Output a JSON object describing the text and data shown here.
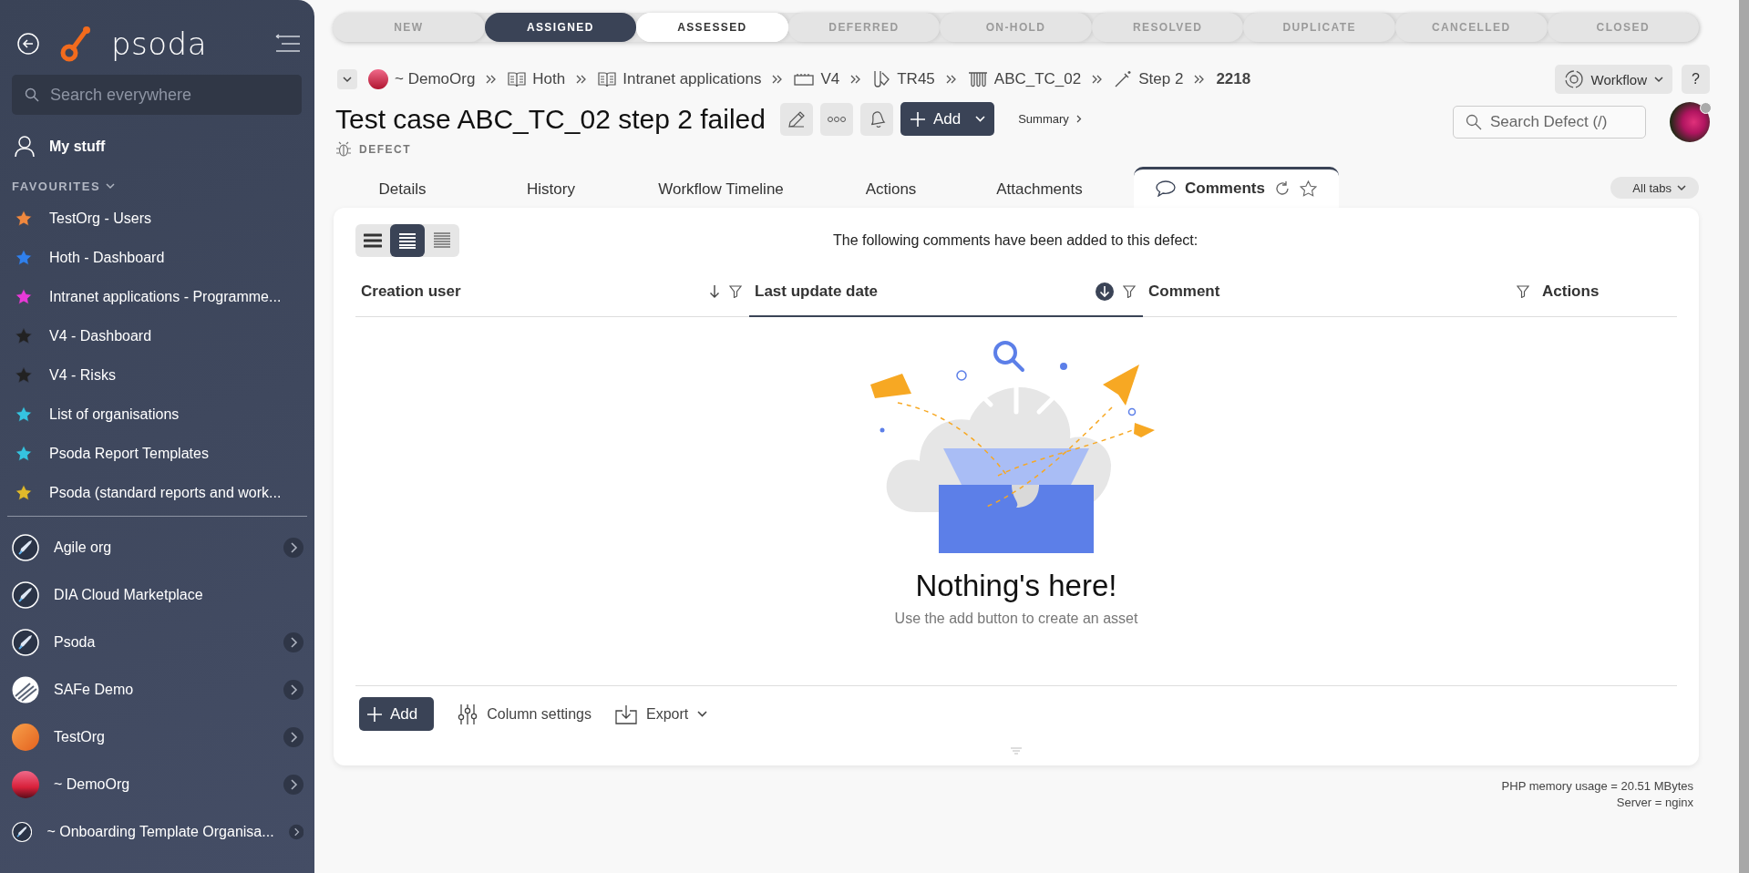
{
  "sidebar": {
    "brand": "psoda",
    "search_placeholder": "Search everywhere",
    "my_stuff": "My stuff",
    "favourites_heading": "FAVOURITES",
    "favourites": [
      {
        "label": "TestOrg - Users",
        "color": "#f0883e"
      },
      {
        "label": "Hoth - Dashboard",
        "color": "#2f80ed"
      },
      {
        "label": "Intranet applications - Programme...",
        "color": "#e83ad8"
      },
      {
        "label": "V4 - Dashboard",
        "color": "#222222"
      },
      {
        "label": "V4 - Risks",
        "color": "#222222"
      },
      {
        "label": "List of organisations",
        "color": "#35c3e0"
      },
      {
        "label": "Psoda Report Templates",
        "color": "#35c3e0"
      },
      {
        "label": "Psoda (standard reports and work...",
        "color": "#e0b92a"
      }
    ],
    "organisations": [
      {
        "label": "Agile org",
        "kind": "rocket",
        "expandable": true
      },
      {
        "label": "DIA Cloud Marketplace",
        "kind": "rocket",
        "expandable": false
      },
      {
        "label": "Psoda",
        "kind": "rocket",
        "expandable": true
      },
      {
        "label": "SAFe Demo",
        "kind": "stripes",
        "expandable": true
      },
      {
        "label": "TestOrg",
        "kind": "orange",
        "expandable": true
      },
      {
        "label": "~ DemoOrg",
        "kind": "sunset",
        "expandable": true
      },
      {
        "label": "~ Onboarding Template Organisa...",
        "kind": "rocket",
        "expandable": true
      }
    ]
  },
  "workflow_stages": [
    {
      "label": "NEW",
      "selected": false,
      "available": false
    },
    {
      "label": "ASSIGNED",
      "selected": true,
      "available": false
    },
    {
      "label": "ASSESSED",
      "selected": false,
      "available": true
    },
    {
      "label": "DEFERRED",
      "selected": false,
      "available": false
    },
    {
      "label": "ON-HOLD",
      "selected": false,
      "available": false
    },
    {
      "label": "RESOLVED",
      "selected": false,
      "available": false
    },
    {
      "label": "DUPLICATE",
      "selected": false,
      "available": false
    },
    {
      "label": "CANCELLED",
      "selected": false,
      "available": false
    },
    {
      "label": "CLOSED",
      "selected": false,
      "available": false
    }
  ],
  "breadcrumbs": [
    {
      "label": "~ DemoOrg",
      "kind": "org"
    },
    {
      "label": "Hoth",
      "kind": "book"
    },
    {
      "label": "Intranet applications",
      "kind": "book"
    },
    {
      "label": "V4",
      "kind": "board"
    },
    {
      "label": "TR45",
      "kind": "flask"
    },
    {
      "label": "ABC_TC_02",
      "kind": "tubes"
    },
    {
      "label": "Step 2",
      "kind": "wand"
    },
    {
      "label": "2218",
      "kind": "current"
    }
  ],
  "header": {
    "title": "Test case ABC_TC_02 step 2 failed",
    "type_label": "DEFECT",
    "add_button": "Add",
    "summary_link": "Summary",
    "workflow_button": "Workflow",
    "help_button": "?",
    "search_placeholder": "Search Defect (/)"
  },
  "tabs": [
    {
      "label": "Details",
      "selected": false
    },
    {
      "label": "History",
      "selected": false
    },
    {
      "label": "Workflow Timeline",
      "selected": false
    },
    {
      "label": "Actions",
      "selected": false
    },
    {
      "label": "Attachments",
      "selected": false
    },
    {
      "label": "Comments",
      "selected": true
    }
  ],
  "all_tabs": "All tabs",
  "comments": {
    "intro": "The following comments have been added to this defect:",
    "view_modes": [
      {
        "kind": "spacious",
        "selected": false
      },
      {
        "kind": "normal",
        "selected": true
      },
      {
        "kind": "compact",
        "selected": false
      }
    ],
    "columns": [
      {
        "label": "Creation user",
        "sortable": true,
        "sorted": false,
        "filterable": true
      },
      {
        "label": "Last update date",
        "sortable": true,
        "sorted": true,
        "filterable": true
      },
      {
        "label": "Comment",
        "sortable": false,
        "sorted": false,
        "filterable": true
      },
      {
        "label": "Actions",
        "sortable": false,
        "sorted": false,
        "filterable": false
      }
    ],
    "empty_title": "Nothing's here!",
    "empty_hint": "Use the add button to create an asset",
    "add_button": "Add",
    "column_settings": "Column settings",
    "export": "Export"
  },
  "footer": [
    "PHP memory usage = 20.51 MBytes",
    "Server = nginx"
  ]
}
